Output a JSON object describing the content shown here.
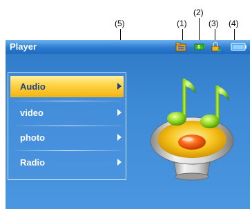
{
  "callouts": {
    "c5": "(5)",
    "c1": "(1)",
    "c2": "(2)",
    "c3": "(3)",
    "c4": "(4)"
  },
  "screen": {
    "title": "Player",
    "status_icons": [
      "folder-icon",
      "battery-charge-icon",
      "lock-icon",
      "battery-icon"
    ],
    "menu": {
      "items": [
        {
          "label": "Audio",
          "selected": true
        },
        {
          "label": "video",
          "selected": false
        },
        {
          "label": "photo",
          "selected": false
        },
        {
          "label": "Radio",
          "selected": false
        }
      ]
    },
    "illustration": "music-speaker-icon"
  },
  "colors": {
    "background": "#3d8ad6",
    "titlebar": "#2d7cd0",
    "selection": "#ffd54a",
    "selected_text": "#1a3e8a"
  }
}
